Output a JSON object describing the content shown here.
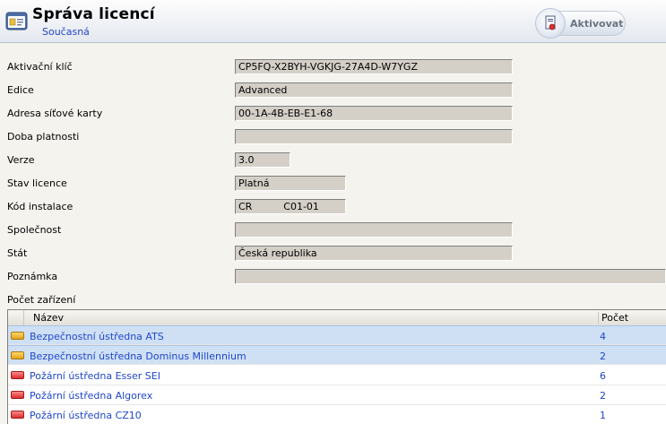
{
  "header": {
    "title": "Správa licencí",
    "subtitle": "Současná",
    "activate_label": "Aktivovat"
  },
  "fields": [
    {
      "label": "Aktivační klíč",
      "value": "CP5FQ-X2BYH-VGKJG-27A4D-W7YGZ"
    },
    {
      "label": "Edice",
      "value": "Advanced"
    },
    {
      "label": "Adresa síťové karty",
      "value": "00-1A-4B-EB-E1-68"
    },
    {
      "label": "Doba platnosti",
      "value": ""
    },
    {
      "label": "Verze",
      "value": "3.0"
    },
    {
      "label": "Stav licence",
      "value": "Platná"
    },
    {
      "label": "Kód instalace",
      "value": "CR          C01-01"
    },
    {
      "label": "Společnost",
      "value": ""
    },
    {
      "label": "Stát",
      "value": "Česká republika"
    },
    {
      "label": "Poznámka",
      "value": ""
    }
  ],
  "devices": {
    "section_label": "Počet zařízení",
    "col_name": "Název",
    "col_count": "Počet",
    "rows": [
      {
        "name": "Bezpečnostní ústředna ATS",
        "count": "4",
        "icon": "security-panel-icon"
      },
      {
        "name": "Bezpečnostní ústředna Dominus Millennium",
        "count": "2",
        "icon": "security-panel-icon"
      },
      {
        "name": "Požární ústředna Esser SEI",
        "count": "6",
        "icon": "fire-panel-icon"
      },
      {
        "name": "Požární ústředna Algorex",
        "count": "2",
        "icon": "fire-panel-icon"
      },
      {
        "name": "Požární ústředna CZ10",
        "count": "1",
        "icon": "fire-panel-icon"
      }
    ]
  }
}
